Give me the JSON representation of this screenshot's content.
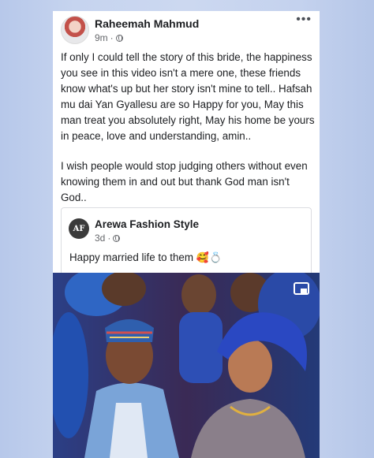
{
  "post": {
    "author": "Raheemah Mahmud",
    "time": "9m",
    "separator": "·",
    "more": "•••",
    "paragraphs": [
      "If only I could tell the story of this bride, the happiness you see in this video isn't a mere one, these friends know what's up but her story isn't mine to tell.. Hafsah mu dai Yan Gyallesu are so Happy for you, May this man treat you absolutely right, May his home be yours in peace, love and understanding, amin..",
      "I wish people would stop judging others without even knowing them in and out but thank God man isn't God.."
    ]
  },
  "shared_post": {
    "avatar_text": "AF",
    "author": "Arewa Fashion Style",
    "time": "3d",
    "separator": "·",
    "text": "Happy married life to them",
    "emojis": "🥰💍"
  },
  "icons": {
    "privacy": "globe-icon",
    "more": "more-options-icon",
    "pip": "picture-in-picture-icon"
  },
  "colors": {
    "background": "#c6d4ef",
    "text": "#1c1e21",
    "meta": "#65676b"
  }
}
